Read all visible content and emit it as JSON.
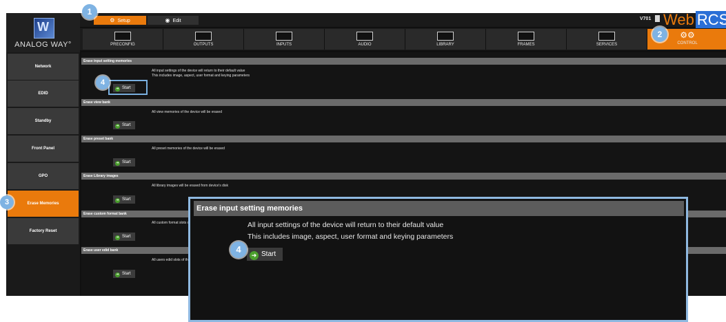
{
  "brand": {
    "logo_text": "ANALOG WAY°",
    "version": "V701",
    "web_label": "Web",
    "rcs_label": "RCS"
  },
  "modes": [
    {
      "label": "Setup",
      "active": true
    },
    {
      "label": "Edit",
      "active": false
    }
  ],
  "nav": [
    {
      "label": "PRECONFIG",
      "icon": "preconfig-icon"
    },
    {
      "label": "OUTPUTS",
      "icon": "outputs-icon"
    },
    {
      "label": "INPUTS",
      "icon": "inputs-icon"
    },
    {
      "label": "AUDIO",
      "icon": "audio-icon"
    },
    {
      "label": "LIBRARY",
      "icon": "library-icon"
    },
    {
      "label": "FRAMES",
      "icon": "frames-icon"
    },
    {
      "label": "SERVICES",
      "icon": "services-icon"
    },
    {
      "label": "CONTROL",
      "icon": "gears-icon",
      "active": true
    }
  ],
  "sidebar": [
    {
      "label": "Network"
    },
    {
      "label": "EDID"
    },
    {
      "label": "Standby"
    },
    {
      "label": "Front Panel"
    },
    {
      "label": "GPO"
    },
    {
      "label": "Erase Memories",
      "active": true
    },
    {
      "label": "Factory Reset"
    }
  ],
  "sections": [
    {
      "title": "Erase input setting memories",
      "lines": [
        "All input settings of the device will return to their default value",
        "This includes image, aspect, user format and keying parameters"
      ],
      "button": "Start"
    },
    {
      "title": "Erase view bank",
      "lines": [
        "All view memories of the device will be erased"
      ],
      "button": "Start"
    },
    {
      "title": "Erase preset bank",
      "lines": [
        "All preset memories of the device will be erased"
      ],
      "button": "Start"
    },
    {
      "title": "Erase Library images",
      "lines": [
        "All library images will be erased from device's disk"
      ],
      "button": "Start"
    },
    {
      "title": "Erase custom format bank",
      "lines": [
        "All custom format slots of the device"
      ],
      "button": "Start"
    },
    {
      "title": "Erase user edid bank",
      "lines": [
        "All users edid slots of the device wil"
      ],
      "button": "Start"
    }
  ],
  "zoom": {
    "title": "Erase input setting memories",
    "line1": "All input settings of the device will return to their default value",
    "line2": "This includes image, aspect, user format and keying parameters",
    "button": "Start"
  },
  "callouts": [
    "1",
    "2",
    "3",
    "4",
    "4"
  ],
  "colors": {
    "accent": "#ea7a0c",
    "callout": "#7fb3e3",
    "go": "#4aa02c",
    "rcs": "#2a6fd6"
  }
}
